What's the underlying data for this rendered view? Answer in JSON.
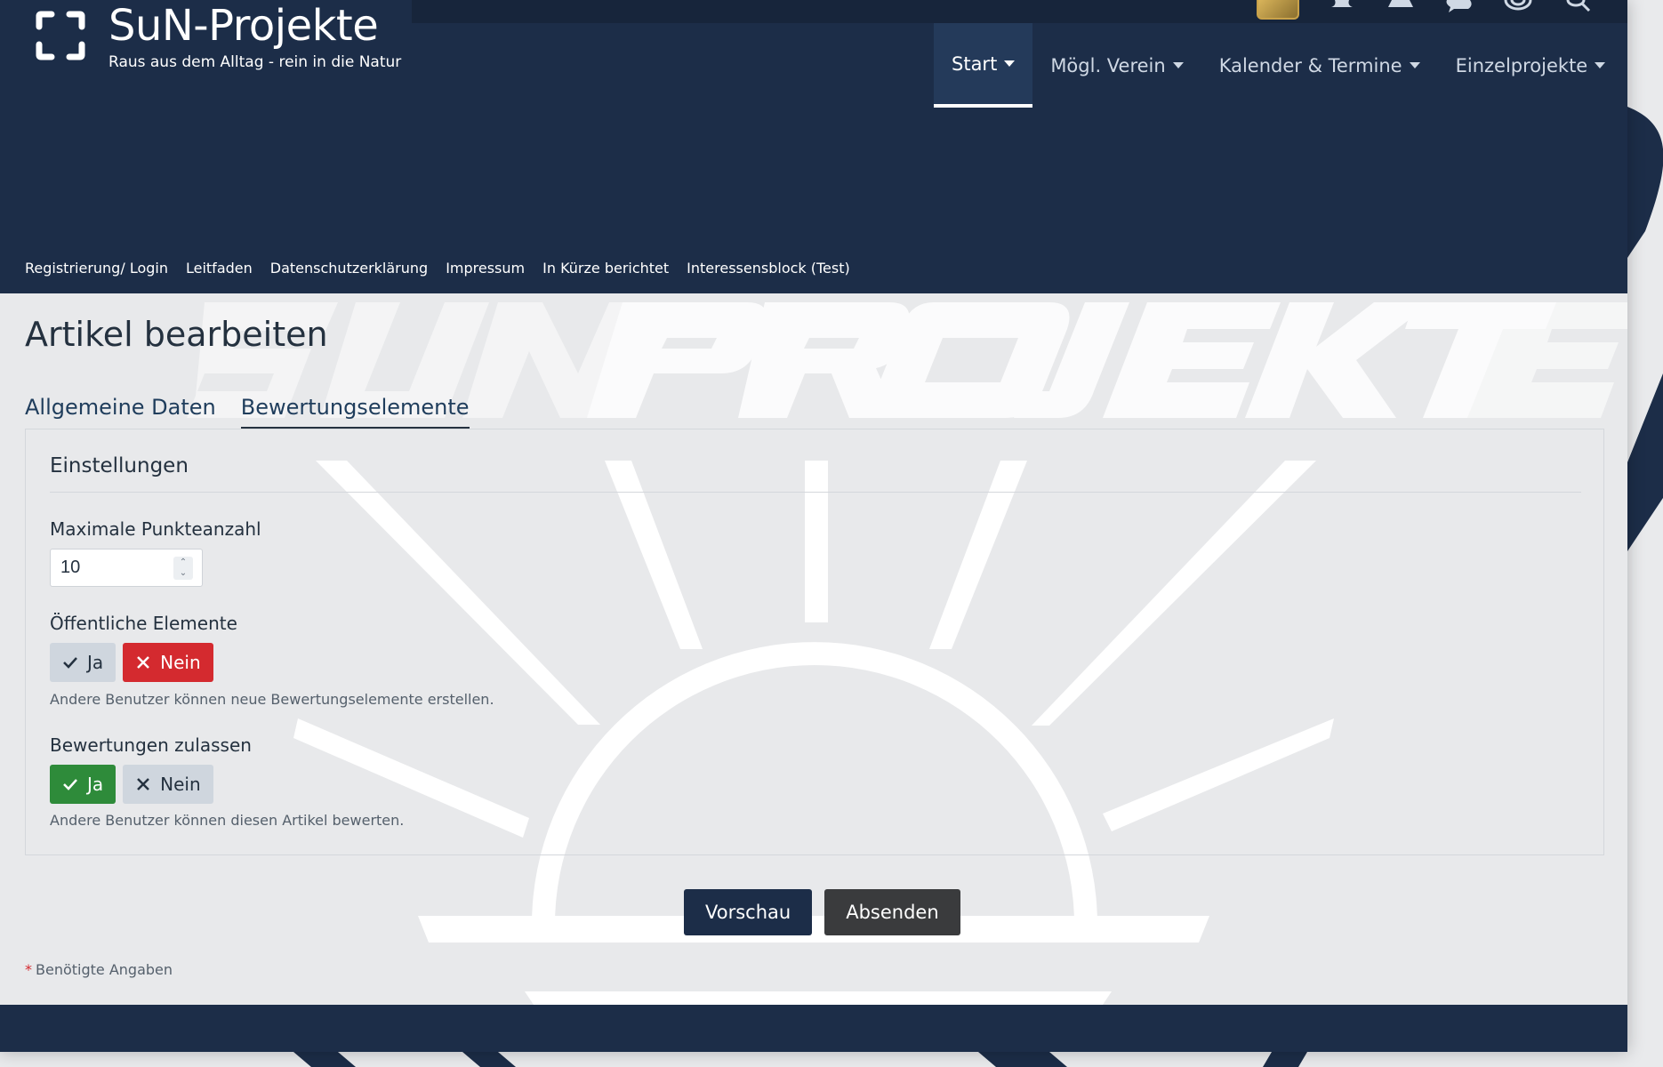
{
  "header": {
    "site_title": "SuN-Projekte",
    "tagline": "Raus aus dem Alltag - rein in die Natur",
    "top_icons": [
      "avatar-icon",
      "bell-icon",
      "warning-icon",
      "chat-icon",
      "target-icon",
      "search-icon"
    ]
  },
  "nav": {
    "items": [
      {
        "label": "Start",
        "active": true
      },
      {
        "label": "Mögl. Verein"
      },
      {
        "label": "Kalender & Termine"
      },
      {
        "label": "Einzelprojekte"
      }
    ]
  },
  "subnav": {
    "items": [
      "Registrierung/ Login",
      "Leitfaden",
      "Datenschutzerklärung",
      "Impressum",
      "In Kürze berichtet",
      "Interessensblock (Test)"
    ]
  },
  "page": {
    "title": "Artikel bearbeiten",
    "tabs": [
      "Allgemeine Daten",
      "Bewertungselemente"
    ]
  },
  "panel": {
    "title": "Einstellungen",
    "max_points_label": "Maximale Punkteanzahl",
    "max_points_value": "10",
    "public_elements_label": "Öffentliche Elemente",
    "public_elements_yes": "Ja",
    "public_elements_no": "Nein",
    "public_elements_selected": "Nein",
    "public_elements_hint": "Andere Benutzer können neue Bewertungselemente erstellen.",
    "ratings_label": "Bewertungen zulassen",
    "ratings_yes": "Ja",
    "ratings_no": "Nein",
    "ratings_selected": "Ja",
    "ratings_hint": "Andere Benutzer können diesen Artikel bewerten."
  },
  "actions": {
    "preview": "Vorschau",
    "submit": "Absenden"
  },
  "footer_note": {
    "required": "Benötigte Angaben"
  },
  "colors": {
    "brand_navy": "#1c2d48",
    "active_red": "#d42a2f",
    "active_green": "#2e8b3a"
  }
}
